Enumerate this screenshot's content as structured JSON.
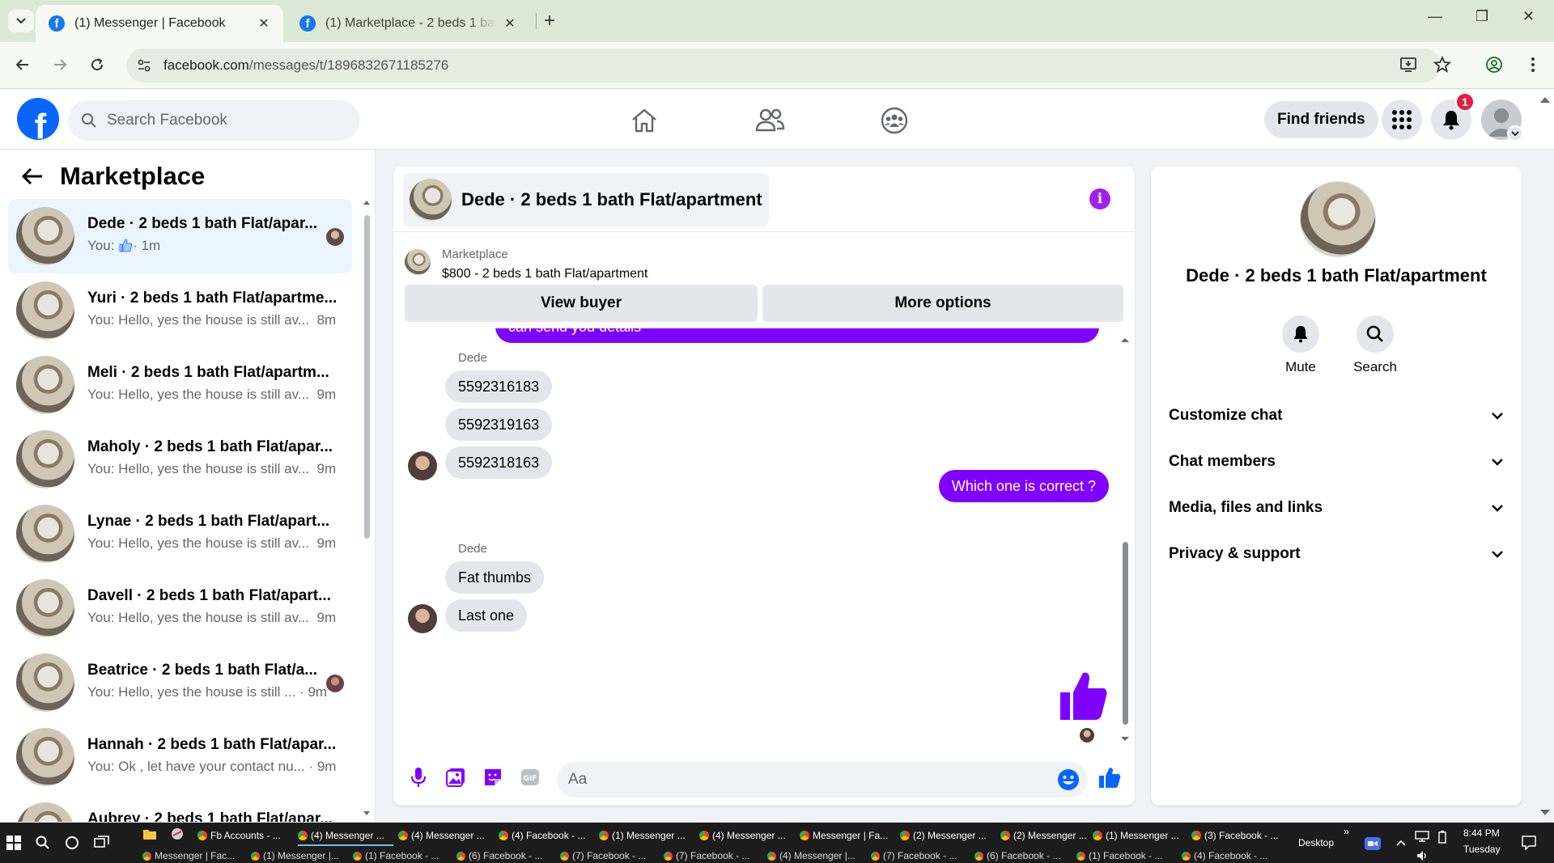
{
  "browser": {
    "tabs": [
      {
        "title": "(1) Messenger | Facebook",
        "active": true
      },
      {
        "title": "(1) Marketplace - 2 beds 1 bath Flat/apartment",
        "active": false
      }
    ],
    "url_host": "facebook.com",
    "url_path": "/messages/t/1896832671185276"
  },
  "fb": {
    "search_placeholder": "Search Facebook",
    "find_friends": "Find friends",
    "notification_count": "1"
  },
  "left": {
    "title": "Marketplace",
    "conversations": [
      {
        "name": "Dede · 2 beds 1 bath Flat/apar...",
        "snippet_prefix": "You: ",
        "snippet": "· 1m",
        "active": true
      },
      {
        "name": "Yuri · 2 beds 1 bath Flat/apartme...",
        "snippet": "You: Hello, yes the house is still av...",
        "time": "8m"
      },
      {
        "name": "Meli · 2 beds 1 bath Flat/apartm...",
        "snippet": "You: Hello, yes the house is still av...",
        "time": "9m"
      },
      {
        "name": "Maholy · 2 beds 1 bath Flat/apar...",
        "snippet": "You: Hello, yes the house is still av...",
        "time": "9m"
      },
      {
        "name": "Lynae · 2 beds 1 bath Flat/apart...",
        "snippet": "You: Hello, yes the house is still av...",
        "time": "9m"
      },
      {
        "name": "Davell · 2 beds 1 bath Flat/apart...",
        "snippet": "You: Hello, yes the house is still av...",
        "time": "9m"
      },
      {
        "name": "Beatrice · 2 beds 1 bath Flat/a...",
        "snippet": "You: Hello, yes the house is still ...",
        "time": "· 9m"
      },
      {
        "name": "Hannah · 2 beds 1 bath Flat/apar...",
        "snippet": "You: Ok , let have your contact nu...",
        "time": "· 9m"
      },
      {
        "name": "Aubrey · 2 beds 1 bath Flat/apar...",
        "snippet": "",
        "time": ""
      }
    ]
  },
  "chat": {
    "title": "Dede · 2 beds 1 bath Flat/apartment",
    "marketplace_label": "Marketplace",
    "listing": "$800 - 2 beds 1 bath Flat/apartment",
    "view_buyer": "View buyer",
    "more_options": "More options",
    "partial_out": "can send you details",
    "sender": "Dede",
    "messages_in_1": [
      "5592316183",
      "5592319163",
      "5592318163"
    ],
    "out_msg": "Which one is correct ?",
    "messages_in_2": [
      "Fat thumbs",
      "Last one"
    ],
    "composer_placeholder": "Aa",
    "accent": "#7f00ff"
  },
  "info": {
    "name": "Dede · 2 beds 1 bath Flat/apartment",
    "mute": "Mute",
    "search": "Search",
    "sections": [
      "Customize chat",
      "Chat members",
      "Media, files and links",
      "Privacy & support"
    ]
  },
  "taskbar": {
    "row1": [
      "Fb Accounts - ...",
      "(4) Messenger ...",
      "(4) Messenger ...",
      "(4) Facebook - ...",
      "(1) Messenger ...",
      "(4) Messenger ...",
      "Messenger | Fa...",
      "(2) Messenger ...",
      "(2) Messenger ...",
      "(1) Messenger ...",
      "(3) Facebook - ..."
    ],
    "row2": [
      "Messenger | Fac...",
      "(1) Messenger |...",
      "(1) Facebook - ...",
      "(6) Facebook - ...",
      "(7) Facebook - ...",
      "(7) Facebook - ...",
      "(4) Messenger |...",
      "(7) Facebook - ...",
      "(6) Facebook - ...",
      "(1) Facebook - ...",
      "(4) Facebook - ..."
    ],
    "desktop": "Desktop",
    "time": "8:44 PM",
    "day": "Tuesday"
  }
}
